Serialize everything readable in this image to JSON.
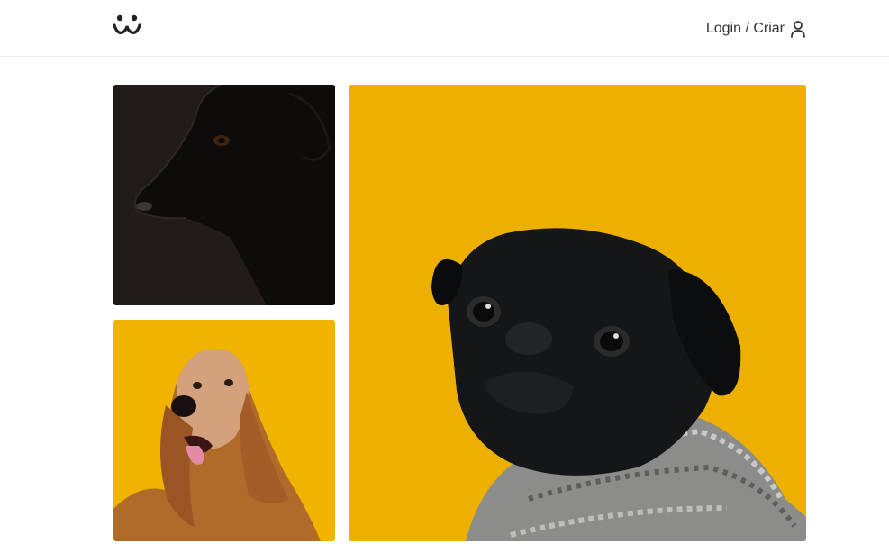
{
  "header": {
    "logo_icon": "dog-face-icon",
    "login_label": "Login / Criar",
    "user_icon": "user-icon"
  },
  "feed": {
    "photos": [
      {
        "subject": "black-dog",
        "background": "#211a1b"
      },
      {
        "subject": "afghan-hound",
        "background": "#f1b300"
      },
      {
        "subject": "pug",
        "background": "#eeb000"
      }
    ]
  }
}
